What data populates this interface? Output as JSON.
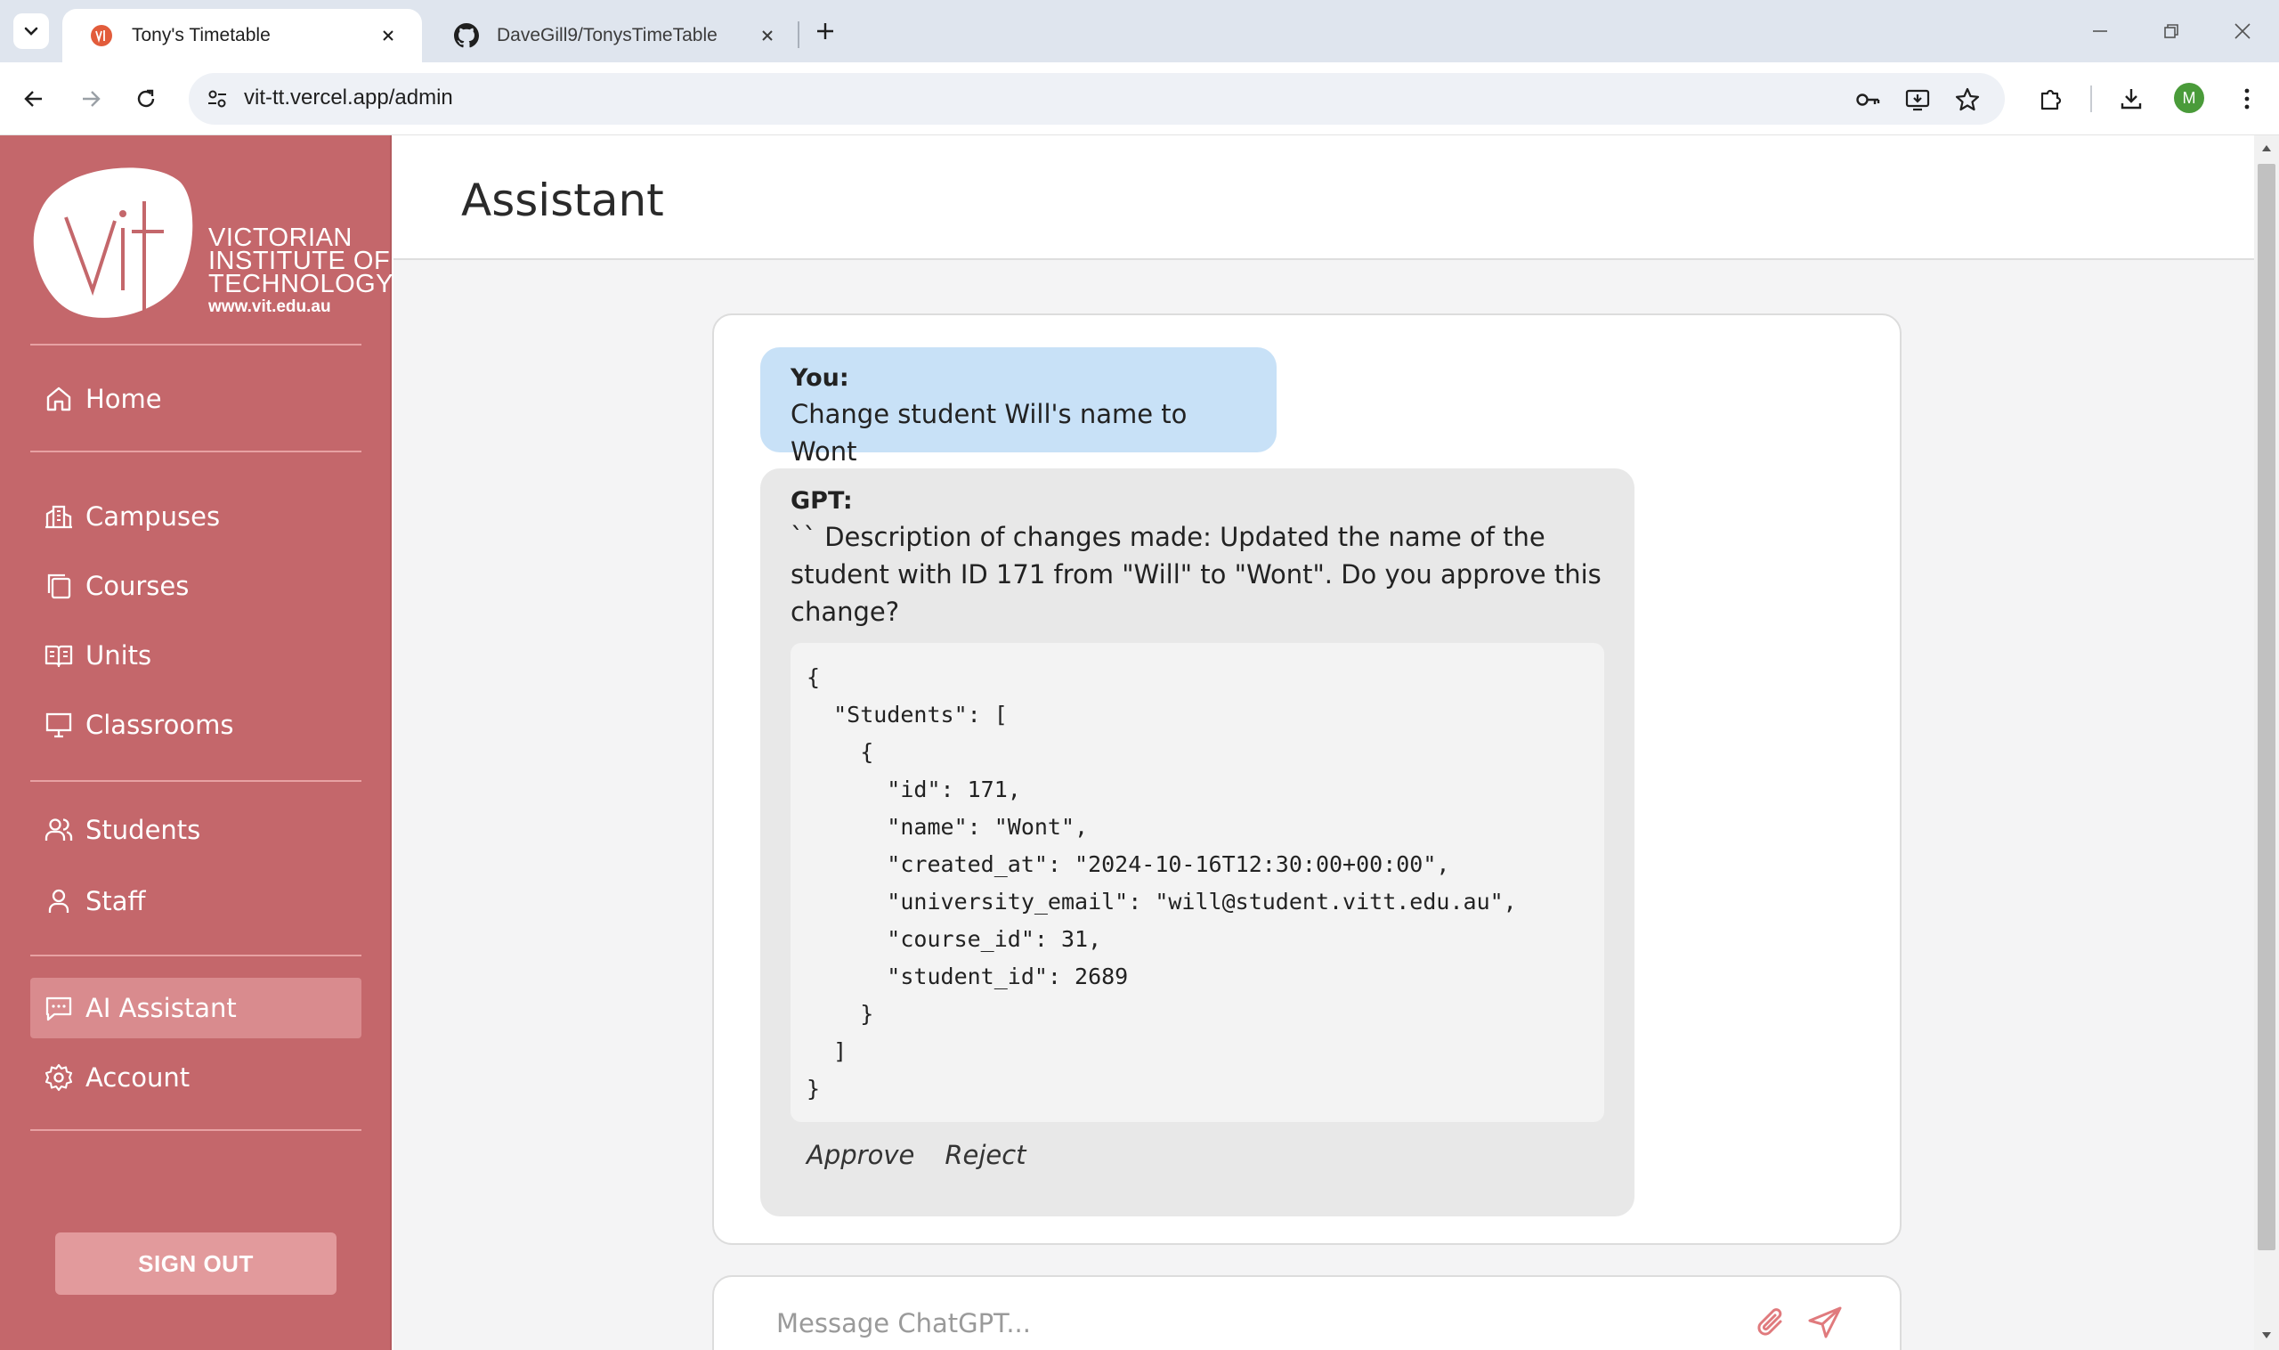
{
  "browser": {
    "tabs": [
      {
        "title": "Tony's Timetable",
        "icon": "vit-favicon",
        "active": true
      },
      {
        "title": "DaveGill9/TonysTimeTable",
        "icon": "github-icon",
        "active": false
      }
    ],
    "url": "vit-tt.vercel.app/admin",
    "profile_initial": "M",
    "profile_color": "#4a9b3a"
  },
  "sidebar": {
    "logo": {
      "line1": "VICTORIAN",
      "line2": "INSTITUTE OF",
      "line3": "TECHNOLOGY",
      "url": "www.vit.edu.au",
      "mark": "vit"
    },
    "items": [
      {
        "label": "Home",
        "icon": "home-icon"
      },
      {
        "label": "Campuses",
        "icon": "campus-icon"
      },
      {
        "label": "Courses",
        "icon": "courses-icon"
      },
      {
        "label": "Units",
        "icon": "book-icon"
      },
      {
        "label": "Classrooms",
        "icon": "presentation-icon"
      },
      {
        "label": "Students",
        "icon": "users-icon"
      },
      {
        "label": "Staff",
        "icon": "user-icon"
      },
      {
        "label": "AI Assistant",
        "icon": "chat-icon",
        "active": true
      },
      {
        "label": "Account",
        "icon": "gear-icon"
      }
    ],
    "signout_label": "SIGN OUT",
    "bg_color": "#c4676b"
  },
  "page": {
    "title": "Assistant"
  },
  "chat": {
    "user": {
      "speaker": "You:",
      "text": "Change student Will's name to Wont"
    },
    "gpt": {
      "speaker": "GPT:",
      "text": "`` Description of changes made: Updated the name of the student with ID 171 from \"Will\" to \"Wont\". Do you approve this change?",
      "code": "{\n  \"Students\": [\n    {\n      \"id\": 171,\n      \"name\": \"Wont\",\n      \"created_at\": \"2024-10-16T12:30:00+00:00\",\n      \"university_email\": \"will@student.vitt.edu.au\",\n      \"course_id\": 31,\n      \"student_id\": 2689\n    }\n  ]\n}",
      "approve_label": "Approve",
      "reject_label": "Reject"
    }
  },
  "composer": {
    "placeholder": "Message ChatGPT...",
    "value": "",
    "attach_icon": "paperclip-icon",
    "send_icon": "send-icon",
    "icon_color": "#e07a7d"
  }
}
